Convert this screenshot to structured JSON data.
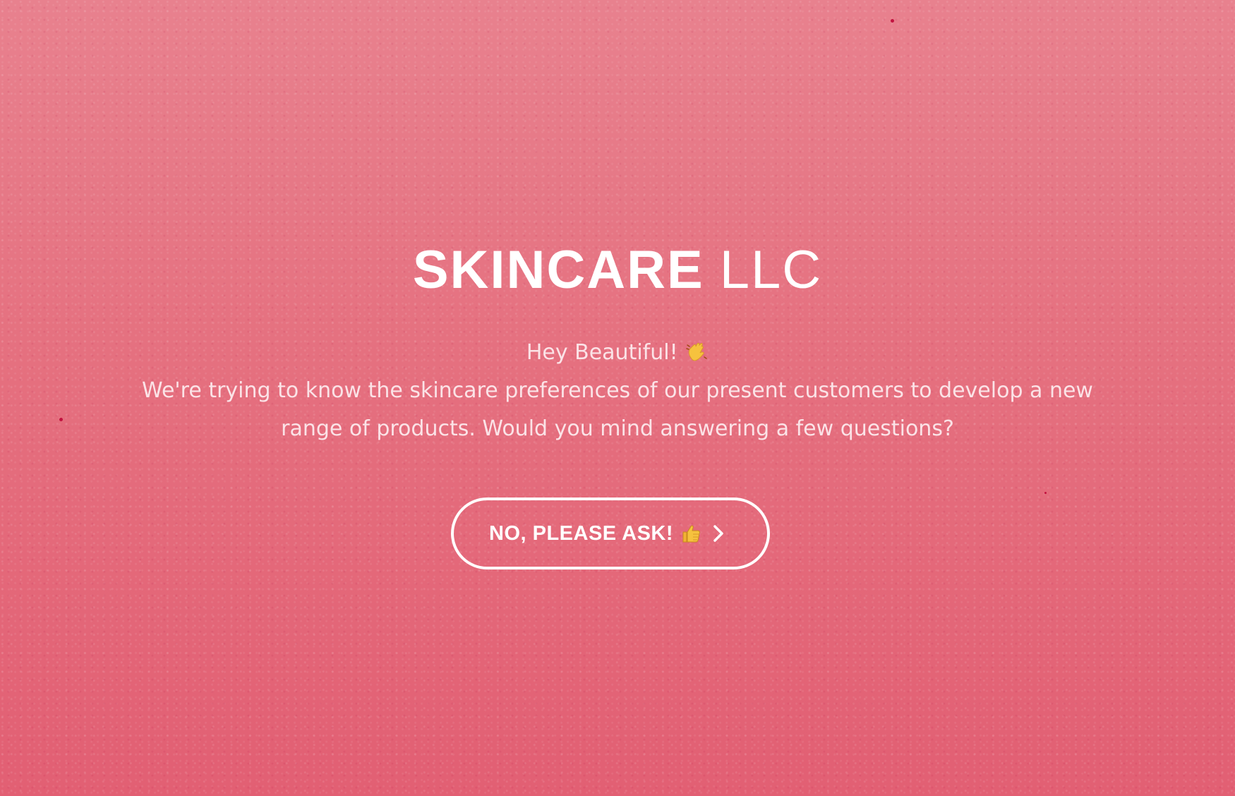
{
  "brand": {
    "name_bold": "SKINCARE",
    "name_light": "LLC"
  },
  "intro": {
    "greeting": "Hey Beautiful!",
    "greeting_icon": "waving-hand-icon",
    "message": "We're trying to know the skincare preferences of our present customers to develop a new range of products.  Would you mind answering a few questions?"
  },
  "cta": {
    "label": "NO, PLEASE ASK!",
    "emoji_icon": "thumbs-up-icon",
    "arrow_icon": "chevron-right-icon"
  },
  "colors": {
    "background": "#e5707f",
    "text": "#ffffff",
    "button_border": "#ffffff"
  }
}
